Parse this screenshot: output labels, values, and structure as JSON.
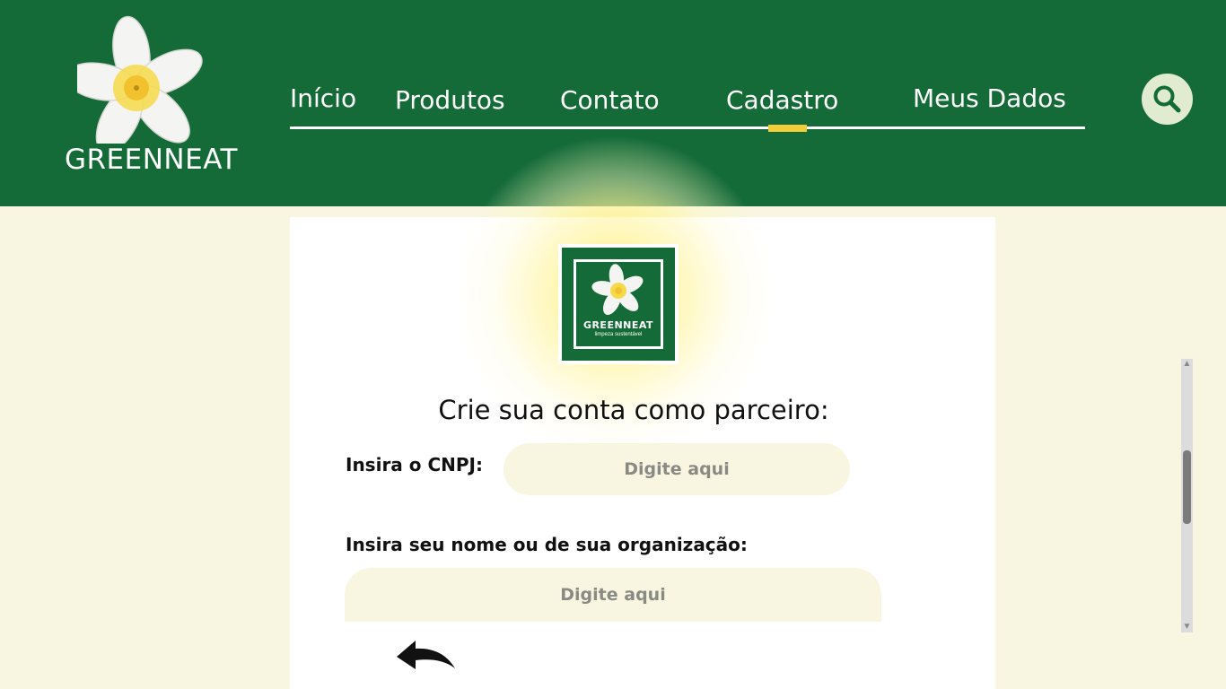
{
  "brand": {
    "name": "GREENNEAT"
  },
  "nav": {
    "items": [
      {
        "label": "Início"
      },
      {
        "label": "Produtos"
      },
      {
        "label": "Contato"
      },
      {
        "label": "Cadastro"
      },
      {
        "label": "Meus Dados"
      }
    ],
    "active": "Cadastro"
  },
  "search": {
    "icon": "search-icon"
  },
  "badge": {
    "name": "GREENNEAT",
    "tagline": "limpeza sustentável"
  },
  "form": {
    "title": "Crie sua conta como parceiro:",
    "cnpj_label": "Insira o CNPJ:",
    "cnpj_placeholder": "Digite aqui",
    "name_label": "Insira seu nome ou de sua organização:",
    "name_placeholder": "Digite aqui",
    "back_icon": "back-arrow-icon"
  },
  "colors": {
    "header_green": "#146b38",
    "page_background": "#f8f6e1",
    "active_indicator": "#f1cd3a",
    "search_button": "#e0ebcf"
  }
}
